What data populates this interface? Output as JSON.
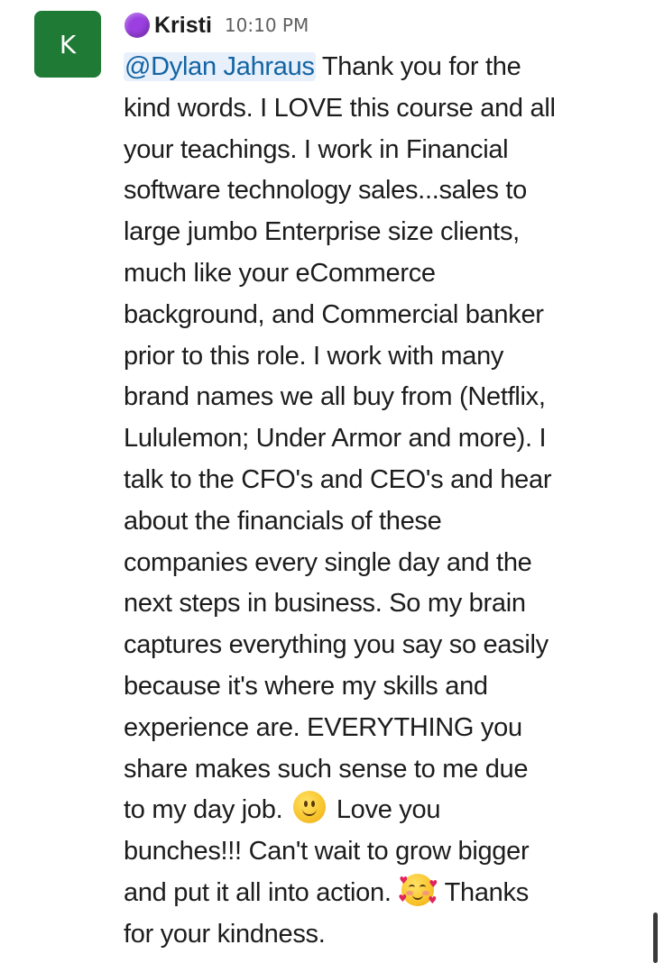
{
  "message": {
    "avatar_initial": "K",
    "sender": "Kristi",
    "time": "10:10 PM",
    "mention": "@Dylan Jahraus",
    "lines": [
      " Thank you for the",
      "kind words. I LOVE this course and all",
      "your teachings. I work in Financial",
      "software technology sales...sales to",
      "large jumbo Enterprise size clients,",
      "much like your eCommerce",
      "background, and Commercial banker",
      "prior to this role. I work with many",
      "brand names we all buy from (Netflix,",
      "Lululemon; Under Armor and more). I",
      "talk to the CFO's and CEO's and hear",
      "about the financials of these",
      "companies every single day and the",
      "next steps in business. So my brain",
      "captures everything you say so easily",
      "because it's where my skills and",
      "experience are. EVERYTHING you",
      "share makes such sense to me due"
    ],
    "line19_before": "to my day job. ",
    "line19_after": " Love you",
    "line20": "bunches!!! Can't wait to grow bigger",
    "line21_before": "and put it all into action. ",
    "line21_after": " Thanks",
    "line22": "for your kindness."
  },
  "icons": {
    "status": "purple-circle-icon",
    "emoji_1": "slightly-smiling-face-icon",
    "emoji_2": "smiling-face-with-hearts-icon"
  },
  "colors": {
    "avatar_bg": "#1e7a34",
    "status_dot": "#9b3fe0",
    "mention_text": "#1264a3",
    "mention_bg": "#e8f0fb"
  }
}
